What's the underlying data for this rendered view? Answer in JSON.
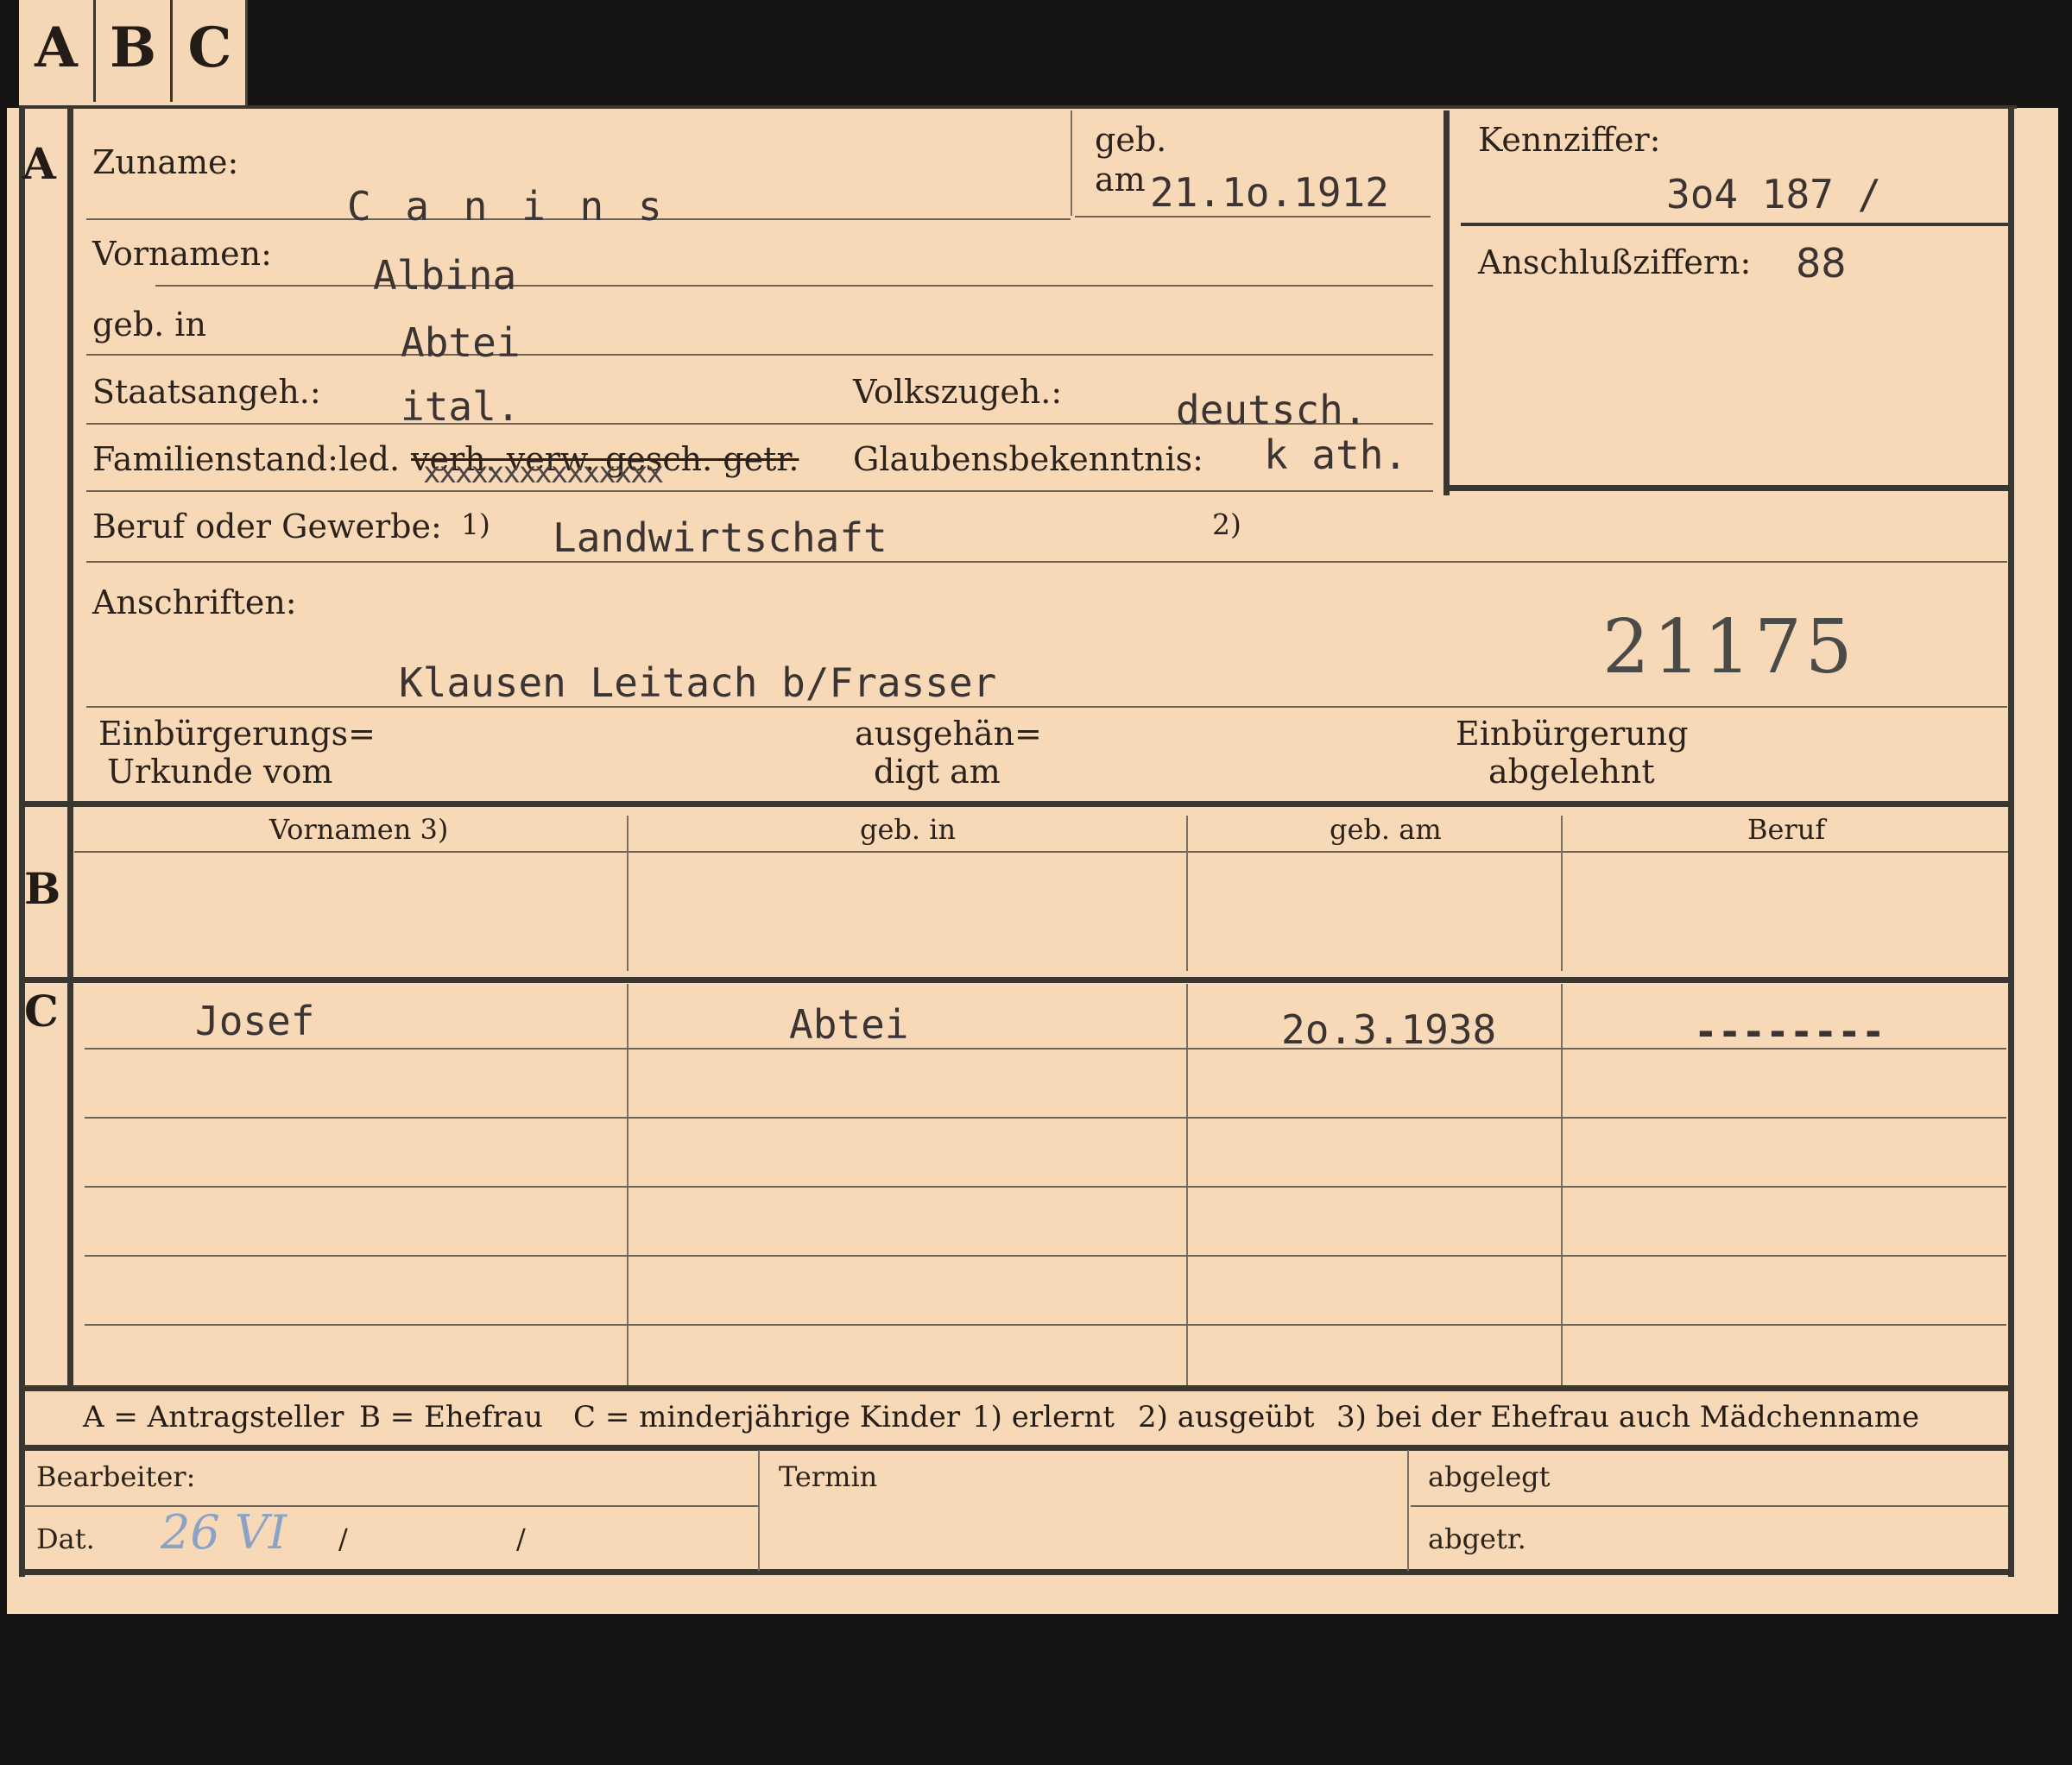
{
  "tabs": [
    "A",
    "B",
    "C"
  ],
  "sections": {
    "a": "A",
    "b": "B",
    "c": "C"
  },
  "applicant": {
    "surname_label": "Zuname:",
    "surname": "C a n i n s",
    "dob_label_1": "geb.",
    "dob_label_2": "am",
    "dob": "21.1o.1912",
    "first_names_label": "Vornamen:",
    "first_names": "Albina",
    "birthplace_label": "geb. in",
    "birthplace": "Abtei",
    "citizenship_label": "Staatsangeh.:",
    "citizenship": "ital.",
    "ethnicity_label": "Volkszugeh.:",
    "ethnicity": "deutsch.",
    "marital_label": "Familienstand:",
    "marital_single": "led.",
    "marital_struck": "verh. verw. gesch. getr.",
    "marital_overtype": "xxxxxxxxxxxxxxx",
    "religion_label": "Glaubensbekenntnis:",
    "religion": "k ath.",
    "occupation_label": "Beruf oder Gewerbe:",
    "footnote1": "1)",
    "occupation": "Landwirtschaft",
    "footnote2": "2)",
    "address_label": "Anschriften:",
    "address": "Klausen Leitach b/Frasser",
    "file_number": "21175",
    "naturalization_cert_1": "Einbürgerungs=",
    "naturalization_cert_2": "Urkunde vom",
    "handed_1": "ausgehän=",
    "handed_2": "digt am",
    "rejected_1": "Einbürgerung",
    "rejected_2": "abgelehnt"
  },
  "id_box": {
    "code_label": "Kennziffer:",
    "code": "3o4 187 /",
    "sub_label": "Anschlußziffern:",
    "sub": "88"
  },
  "spouse_table": {
    "headers": [
      "Vornamen 3)",
      "geb. in",
      "geb. am",
      "Beruf"
    ]
  },
  "children": [
    {
      "name": "Josef",
      "birthplace": "Abtei",
      "dob": "2o.3.1938",
      "occupation": "--------"
    }
  ],
  "legend": {
    "a": "A = Antragsteller",
    "b": "B = Ehefrau",
    "c": "C = minderjährige Kinder",
    "f1": "1) erlernt",
    "f2": "2) ausgeübt",
    "f3": "3) bei der Ehefrau auch Mädchenname"
  },
  "footer": {
    "clerk_label": "Bearbeiter:",
    "date_label": "Dat.",
    "date_handwritten": "26 VI",
    "slash1": "/",
    "slash2": "/",
    "deadline_label": "Termin",
    "filed_label": "abgelegt",
    "transferred_label": "abgetr."
  }
}
